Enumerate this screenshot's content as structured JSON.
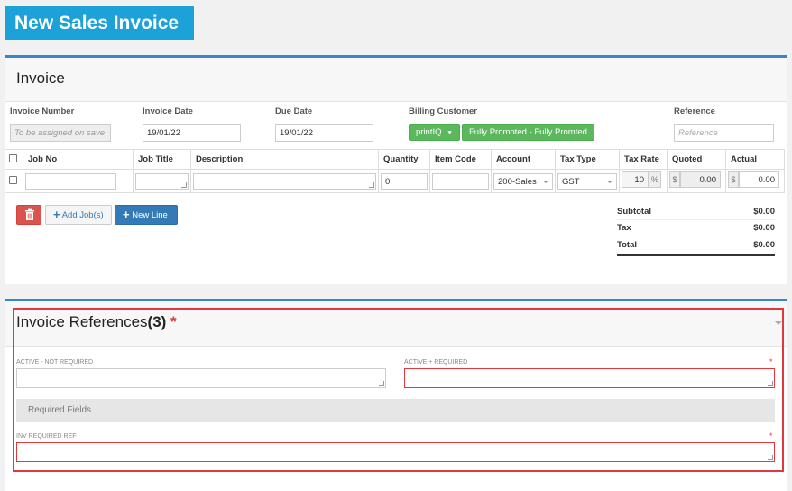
{
  "page": {
    "title": "New Sales Invoice"
  },
  "invoice": {
    "heading": "Invoice",
    "fields": {
      "invoice_number": {
        "label": "Invoice Number",
        "placeholder": "To be assigned on save"
      },
      "invoice_date": {
        "label": "Invoice Date",
        "value": "19/01/22"
      },
      "due_date": {
        "label": "Due Date",
        "value": "19/01/22"
      },
      "billing_customer": {
        "label": "Billing Customer",
        "customer_button": "printIQ",
        "status_button": "Fully Promoted - Fully Promted"
      },
      "reference": {
        "label": "Reference",
        "placeholder": "Reference"
      }
    },
    "table": {
      "headers": [
        "Job No",
        "Job Title",
        "Description",
        "Quantity",
        "Item Code",
        "Account",
        "Tax Type",
        "Tax Rate",
        "Quoted",
        "Actual"
      ],
      "row": {
        "job_no": "",
        "job_title": "",
        "description": "",
        "quantity": "0",
        "item_code": "",
        "account": "200-Sales",
        "tax_type": "GST",
        "tax_rate": "10",
        "tax_rate_suffix": "%",
        "quoted_prefix": "$",
        "quoted": "0.00",
        "actual_prefix": "$",
        "actual": "0.00"
      }
    },
    "actions": {
      "delete_icon": "trash-icon",
      "add_jobs": "Add Job(s)",
      "new_line": "New Line"
    },
    "totals": {
      "subtotal_label": "Subtotal",
      "subtotal": "$0.00",
      "tax_label": "Tax",
      "tax": "$0.00",
      "total_label": "Total",
      "total": "$0.00"
    }
  },
  "references": {
    "heading": "Invoice References",
    "count": "(3)",
    "required_marker": "*",
    "fields": {
      "active_not_required": "ACTIVE - NOT REQUIRED",
      "active_required": "ACTIVE + REQUIRED",
      "section_label": "Required Fields",
      "inv_required_ref": "INV REQUIRED REF"
    }
  },
  "colors": {
    "accent": "#1da1d9",
    "panel_border": "#3b86c9",
    "green": "#5cb85c",
    "danger": "#d9534f",
    "primary": "#337ab7",
    "highlight": "#e0383d"
  }
}
